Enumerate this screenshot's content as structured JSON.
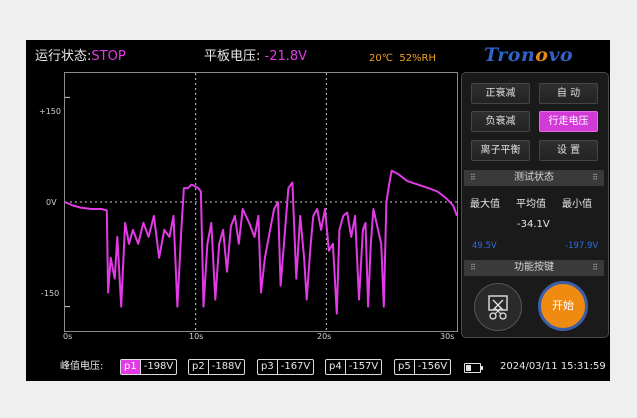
{
  "header": {
    "status_label": "运行状态:",
    "status_value": "STOP",
    "voltage_label": "平板电压:",
    "voltage_value": "-21.8V",
    "temperature": "20℃",
    "humidity": "52%RH"
  },
  "logo": {
    "text_a": "Tron",
    "text_o": "o",
    "text_b": "vo"
  },
  "buttons": [
    {
      "label": "正衰减",
      "active": false
    },
    {
      "label": "自 动",
      "active": false
    },
    {
      "label": "负衰减",
      "active": false
    },
    {
      "label": "行走电压",
      "active": true
    },
    {
      "label": "离子平衡",
      "active": false
    },
    {
      "label": "设 置",
      "active": false
    }
  ],
  "test_status": {
    "title": "测试状态",
    "max_label": "最大值",
    "avg_label": "平均值",
    "min_label": "最小值",
    "avg_value": "-34.1V",
    "max_value": "49.5V",
    "min_value": "-197.9V"
  },
  "function_keys": {
    "title": "功能按键",
    "start_label": "开始"
  },
  "footer": {
    "peak_label": "峰值电压:",
    "peaks": [
      {
        "label": "p1",
        "value": "-198V",
        "selected": true
      },
      {
        "label": "p2",
        "value": "-188V",
        "selected": false
      },
      {
        "label": "p3",
        "value": "-167V",
        "selected": false
      },
      {
        "label": "p4",
        "value": "-157V",
        "selected": false
      },
      {
        "label": "p5",
        "value": "-156V",
        "selected": false
      }
    ],
    "datetime": "2024/03/11 15:31:59"
  },
  "colors": {
    "trace": "#e23be6",
    "accent_orange": "#e38a1c",
    "logo_blue": "#2f63c8",
    "value_blue": "#2f6ddc"
  },
  "chart_data": {
    "type": "line",
    "title": "",
    "xlabel": "",
    "ylabel": "",
    "xlim": [
      0,
      30
    ],
    "ylim": [
      -185,
      185
    ],
    "x_ticks": [
      "0s",
      "10s",
      "20s",
      "30s"
    ],
    "y_ticks": [
      "+150",
      "0V",
      "-150"
    ],
    "grid": "dashed vertical at 10s and 20s, dashed horizontal at 0V",
    "series": [
      {
        "color": "#e23be6",
        "points": [
          [
            0,
            0
          ],
          [
            0.6,
            -5
          ],
          [
            1.2,
            -8
          ],
          [
            2,
            -10
          ],
          [
            2.8,
            -10
          ],
          [
            3.2,
            -12
          ],
          [
            3.3,
            -130
          ],
          [
            3.5,
            -80
          ],
          [
            3.8,
            -110
          ],
          [
            4.0,
            -50
          ],
          [
            4.3,
            -150
          ],
          [
            4.6,
            -30
          ],
          [
            4.9,
            -60
          ],
          [
            5.2,
            -40
          ],
          [
            5.6,
            -60
          ],
          [
            6.0,
            -30
          ],
          [
            6.4,
            -50
          ],
          [
            6.8,
            -20
          ],
          [
            7.2,
            -80
          ],
          [
            7.6,
            -40
          ],
          [
            8.0,
            -50
          ],
          [
            8.3,
            -20
          ],
          [
            8.6,
            -150
          ],
          [
            8.9,
            -40
          ],
          [
            9.1,
            20
          ],
          [
            9.4,
            20
          ],
          [
            9.7,
            25
          ],
          [
            10.2,
            20
          ],
          [
            10.4,
            15
          ],
          [
            10.6,
            -150
          ],
          [
            10.9,
            -60
          ],
          [
            11.2,
            -30
          ],
          [
            11.5,
            -140
          ],
          [
            11.8,
            -60
          ],
          [
            12.1,
            -40
          ],
          [
            12.4,
            -100
          ],
          [
            12.7,
            -35
          ],
          [
            13.0,
            -20
          ],
          [
            13.3,
            -60
          ],
          [
            13.6,
            -10
          ],
          [
            14.1,
            -30
          ],
          [
            14.5,
            -50
          ],
          [
            14.8,
            -20
          ],
          [
            15.0,
            -130
          ],
          [
            15.3,
            -80
          ],
          [
            15.7,
            -40
          ],
          [
            16.0,
            -10
          ],
          [
            16.3,
            0
          ],
          [
            16.5,
            -120
          ],
          [
            16.8,
            -50
          ],
          [
            17.1,
            20
          ],
          [
            17.4,
            28
          ],
          [
            17.7,
            -110
          ],
          [
            18.0,
            -20
          ],
          [
            18.3,
            -80
          ],
          [
            18.5,
            -140
          ],
          [
            18.8,
            -60
          ],
          [
            19.0,
            -20
          ],
          [
            19.3,
            -10
          ],
          [
            19.6,
            -40
          ],
          [
            19.9,
            -10
          ],
          [
            20.2,
            -70
          ],
          [
            20.5,
            -60
          ],
          [
            20.8,
            -160
          ],
          [
            21.0,
            -40
          ],
          [
            21.3,
            -20
          ],
          [
            21.6,
            -15
          ],
          [
            21.9,
            -50
          ],
          [
            22.2,
            -20
          ],
          [
            22.5,
            -140
          ],
          [
            22.8,
            -40
          ],
          [
            23.0,
            -30
          ],
          [
            23.2,
            -150
          ],
          [
            23.4,
            -60
          ],
          [
            23.6,
            -10
          ],
          [
            23.9,
            -35
          ],
          [
            24.2,
            -60
          ],
          [
            24.4,
            -150
          ],
          [
            24.6,
            0
          ],
          [
            24.8,
            25
          ],
          [
            25.0,
            45
          ],
          [
            25.5,
            40
          ],
          [
            26.2,
            30
          ],
          [
            27.0,
            25
          ],
          [
            27.8,
            20
          ],
          [
            28.5,
            15
          ],
          [
            29.2,
            5
          ],
          [
            29.7,
            -5
          ],
          [
            30,
            -20
          ]
        ]
      }
    ]
  }
}
